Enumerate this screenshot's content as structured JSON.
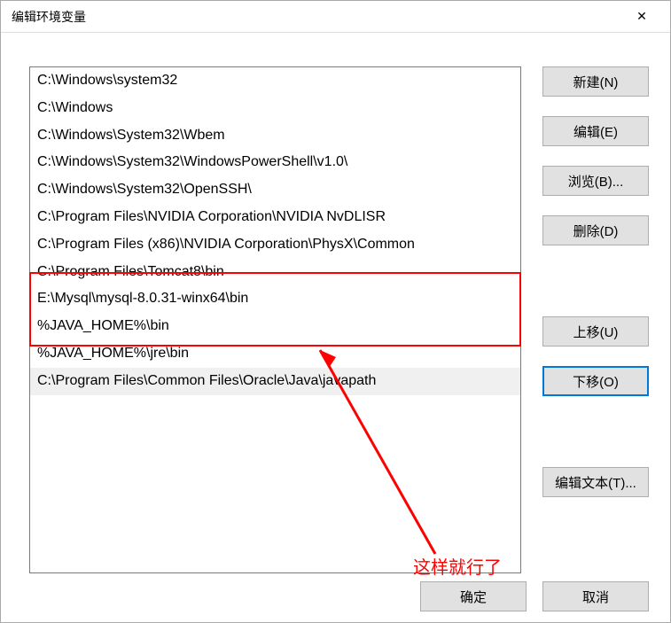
{
  "title": "编辑环境变量",
  "list": {
    "items": [
      "C:\\Windows\\system32",
      "C:\\Windows",
      "C:\\Windows\\System32\\Wbem",
      "C:\\Windows\\System32\\WindowsPowerShell\\v1.0\\",
      "C:\\Windows\\System32\\OpenSSH\\",
      "C:\\Program Files\\NVIDIA Corporation\\NVIDIA NvDLISR",
      "C:\\Program Files (x86)\\NVIDIA Corporation\\PhysX\\Common",
      "C:\\Program Files\\Tomcat8\\bin",
      "E:\\Mysql\\mysql-8.0.31-winx64\\bin",
      "%JAVA_HOME%\\bin",
      "%JAVA_HOME%\\jre\\bin",
      "C:\\Program Files\\Common Files\\Oracle\\Java\\javapath"
    ],
    "selected_index": 11
  },
  "buttons": {
    "new": "新建(N)",
    "edit": "编辑(E)",
    "browse": "浏览(B)...",
    "delete": "删除(D)",
    "move_up": "上移(U)",
    "move_down": "下移(O)",
    "edit_text": "编辑文本(T)...",
    "ok": "确定",
    "cancel": "取消"
  },
  "annotation": {
    "text": "这样就行了"
  }
}
